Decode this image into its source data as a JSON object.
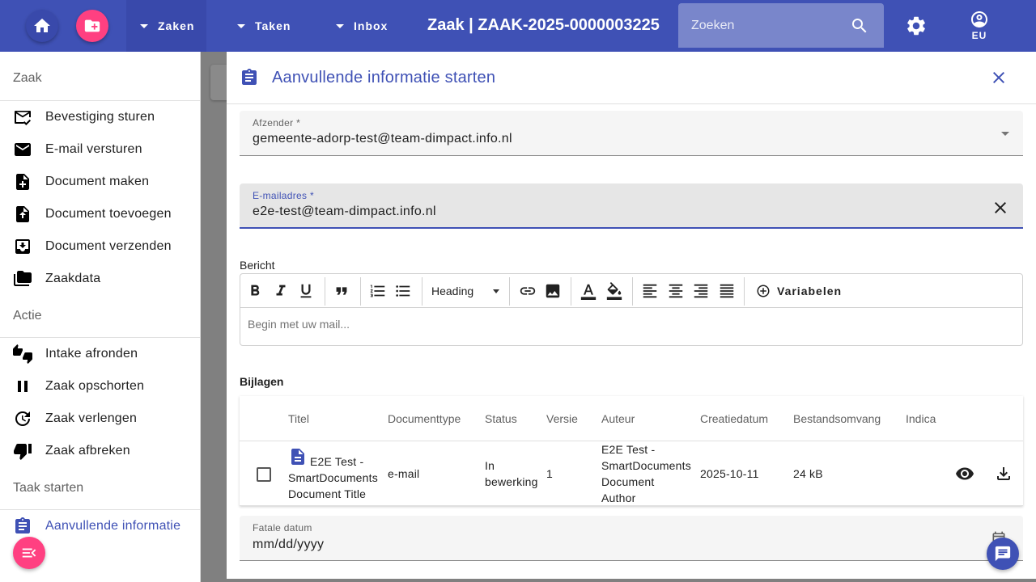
{
  "topbar": {
    "menu_zaken": "Zaken",
    "menu_taken": "Taken",
    "menu_inbox": "Inbox",
    "page_title": "Zaak | ZAAK-2025-0000003225",
    "search_placeholder": "Zoeken",
    "user_label": "EU"
  },
  "sidebar": {
    "sections": [
      {
        "title": "Zaak",
        "items": [
          "Bevestiging sturen",
          "E-mail versturen",
          "Document maken",
          "Document toevoegen",
          "Document verzenden",
          "Zaakdata"
        ]
      },
      {
        "title": "Actie",
        "items": [
          "Intake afronden",
          "Zaak opschorten",
          "Zaak verlengen",
          "Zaak afbreken"
        ]
      },
      {
        "title": "Taak starten",
        "items": [
          "Aanvullende informatie"
        ]
      }
    ]
  },
  "drawer": {
    "title": "Aanvullende informatie starten",
    "afzender": {
      "label": "Afzender *",
      "value": "gemeente-adorp-test@team-dimpact.info.nl"
    },
    "email": {
      "label": "E-mailadres *",
      "value": "e2e-test@team-dimpact.info.nl"
    },
    "bericht_label": "Bericht",
    "toolbar": {
      "heading": "Heading",
      "variables": "Variabelen"
    },
    "editor_placeholder": "Begin met uw mail...",
    "bijlagen_label": "Bijlagen",
    "table": {
      "headers": [
        "Titel",
        "Documenttype",
        "Status",
        "Versie",
        "Auteur",
        "Creatiedatum",
        "Bestandsomvang",
        "Indica"
      ],
      "rows": [
        {
          "titel": [
            "E2E Test -",
            "SmartDocuments",
            "Document Title"
          ],
          "documenttype": "e-mail",
          "status": [
            "In",
            "bewerking"
          ],
          "versie": "1",
          "auteur": [
            "E2E Test -",
            "SmartDocuments",
            "Document",
            "Author"
          ],
          "creatiedatum": "2025-10-11",
          "bestandsomvang": "24 kB"
        }
      ]
    },
    "fatale_datum": {
      "label": "Fatale datum",
      "value": "mm/dd/yyyy"
    }
  },
  "colors": {
    "primary": "#3f51b5",
    "accent": "#ff4081"
  }
}
